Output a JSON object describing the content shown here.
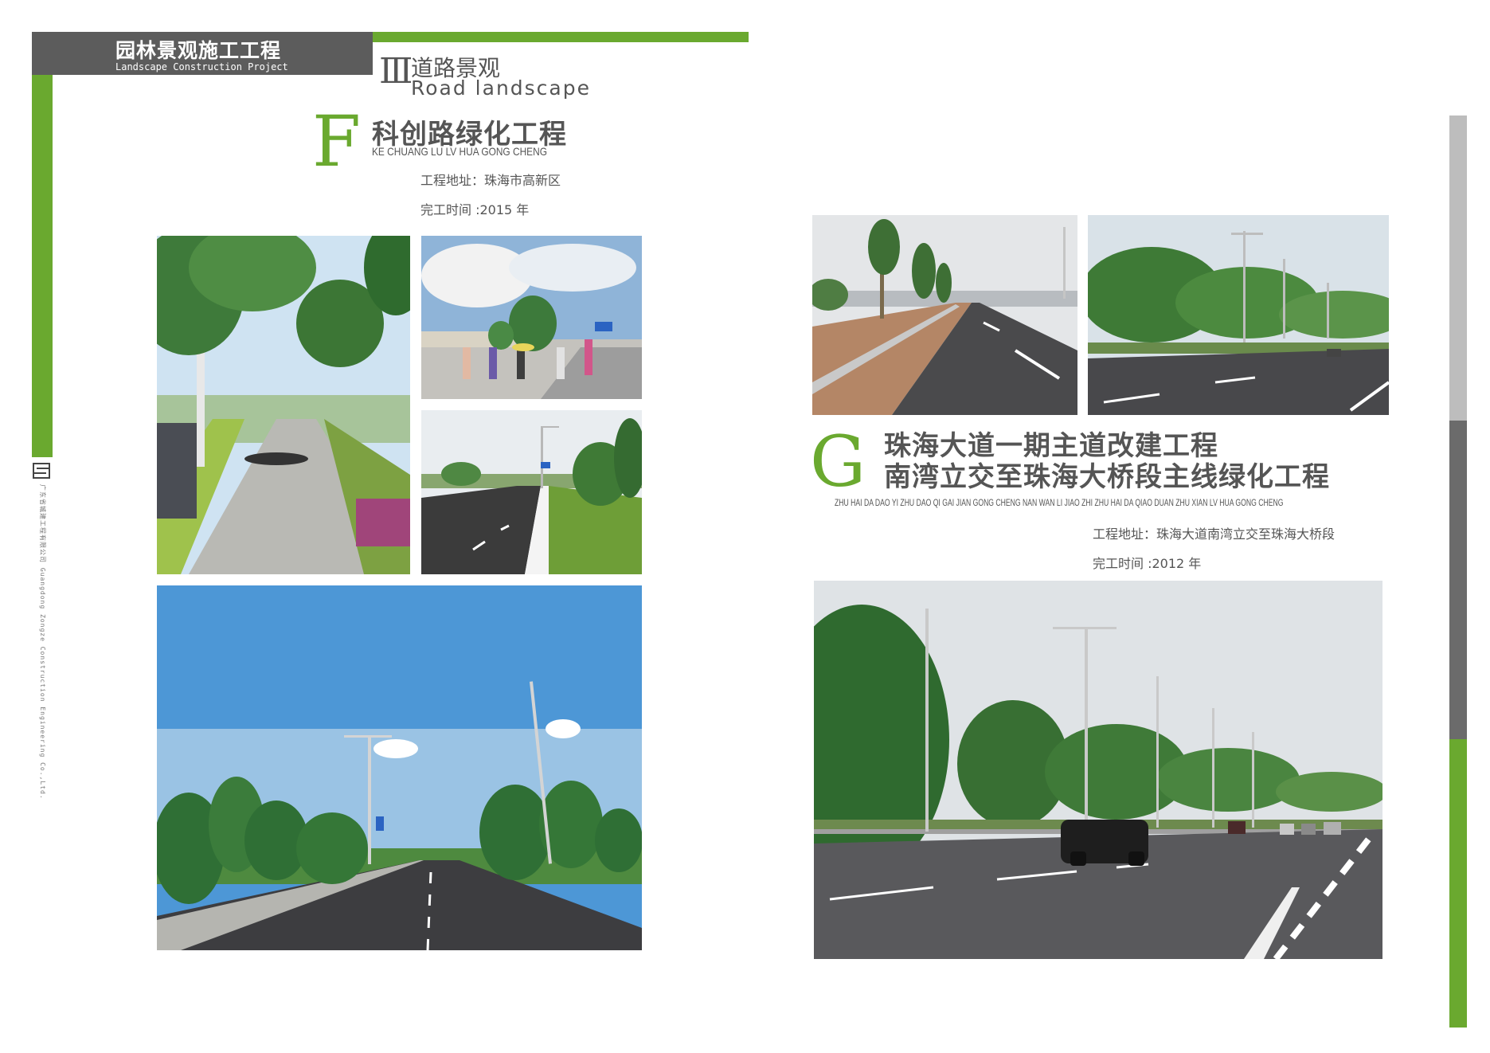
{
  "header": {
    "title_cn": "园林景观施工工程",
    "title_en": "Landscape Construction Project"
  },
  "section": {
    "roman": "Ⅲ",
    "title_cn": "道路景观",
    "title_en": "Road landscape"
  },
  "sidebar": {
    "company_cn": "广东省城建工程有限公司",
    "company_en": "Guangdong Zongze Construction Engineering Co.,Ltd."
  },
  "project_f": {
    "letter": "F",
    "title": "科创路绿化工程",
    "pinyin": "KE CHUANG LU LV HUA GONG CHENG",
    "address": "工程地址：珠海市高新区",
    "completion": "完工时间 :2015 年"
  },
  "project_g": {
    "letter": "G",
    "title_line1": "珠海大道一期主道改建工程",
    "title_line2": "南湾立交至珠海大桥段主线绿化工程",
    "pinyin": "ZHU HAI DA DAO YI ZHU DAO QI GAI JIAN GONG CHENG NAN WAN LI JIAO ZHI ZHU HAI DA QIAO DUAN ZHU XIAN LV HUA GONG CHENG",
    "address": "工程地址：珠海大道南湾立交至珠海大桥段",
    "completion": "完工时间 :2012 年"
  },
  "colors": {
    "accent_green": "#6aa92f",
    "header_gray": "#5c5c5c",
    "text_gray": "#555555"
  }
}
